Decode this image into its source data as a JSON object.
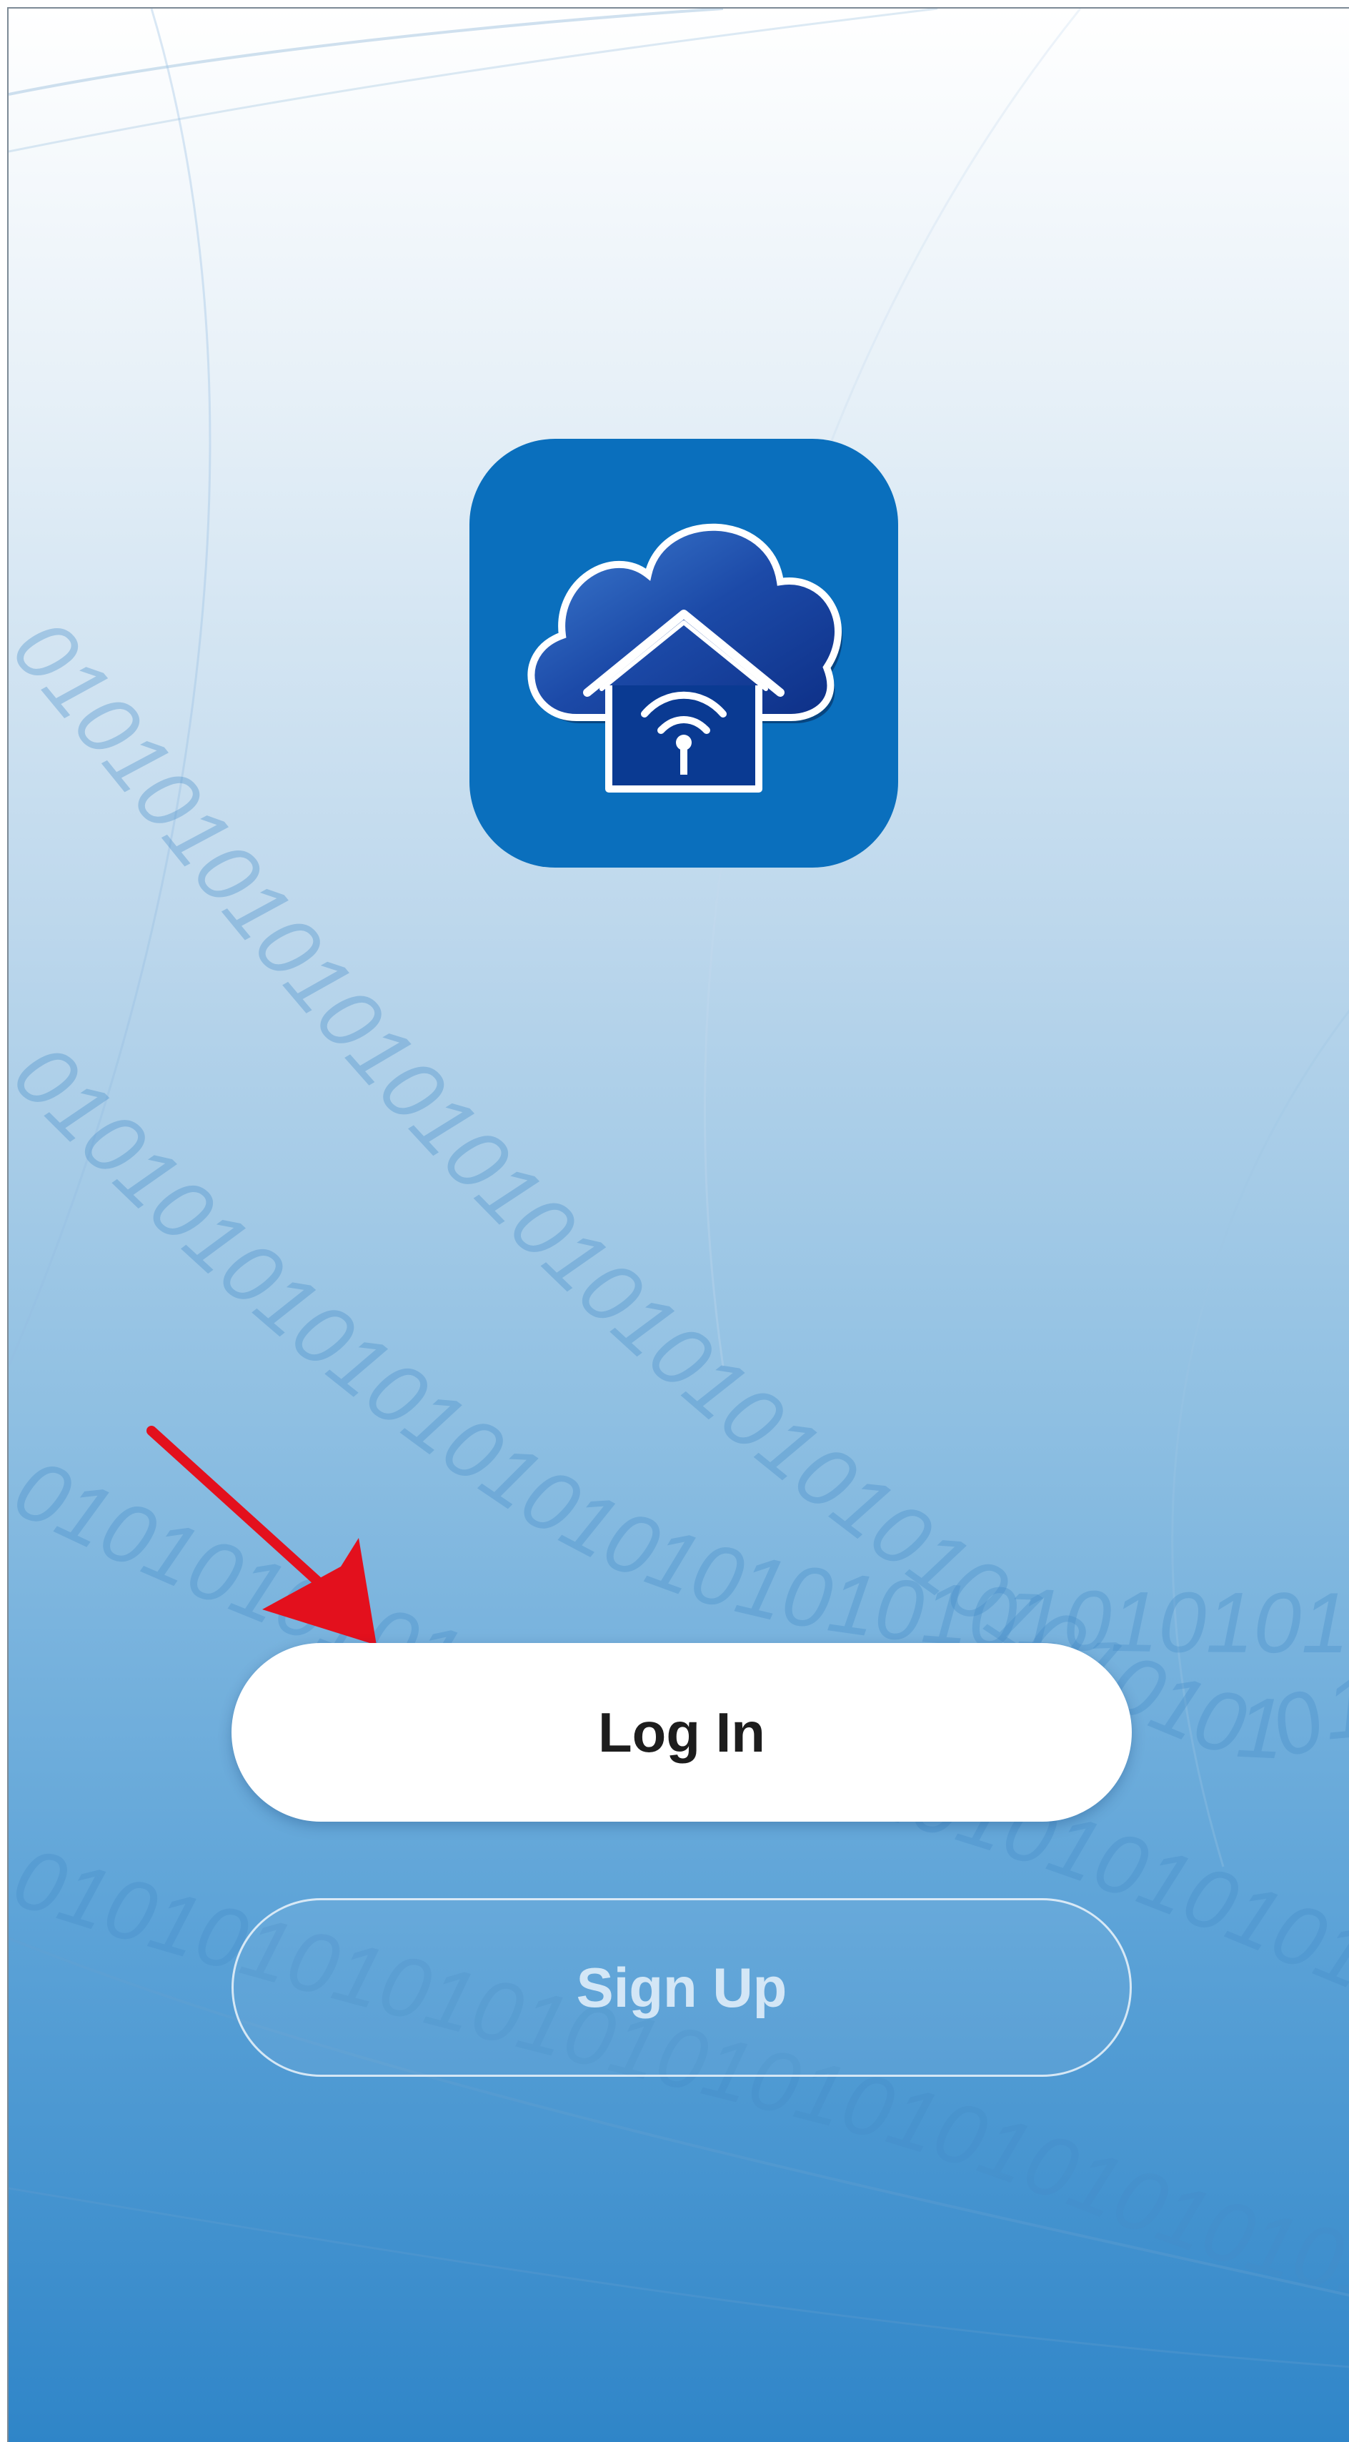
{
  "app": {
    "logo_icon": "cloud-home-wifi-icon"
  },
  "background": {
    "pattern": "binary-digits",
    "binary_text": "0101010101010101010101010101010101010101"
  },
  "buttons": {
    "login_label": "Log In",
    "signup_label": "Sign Up"
  },
  "annotation": {
    "arrow_icon": "red-arrow-icon",
    "arrow_color": "#e3101d"
  },
  "colors": {
    "logo_bg": "#0a6fbd",
    "cloud": "#1746a6",
    "button_text": "#1d1d1d"
  }
}
